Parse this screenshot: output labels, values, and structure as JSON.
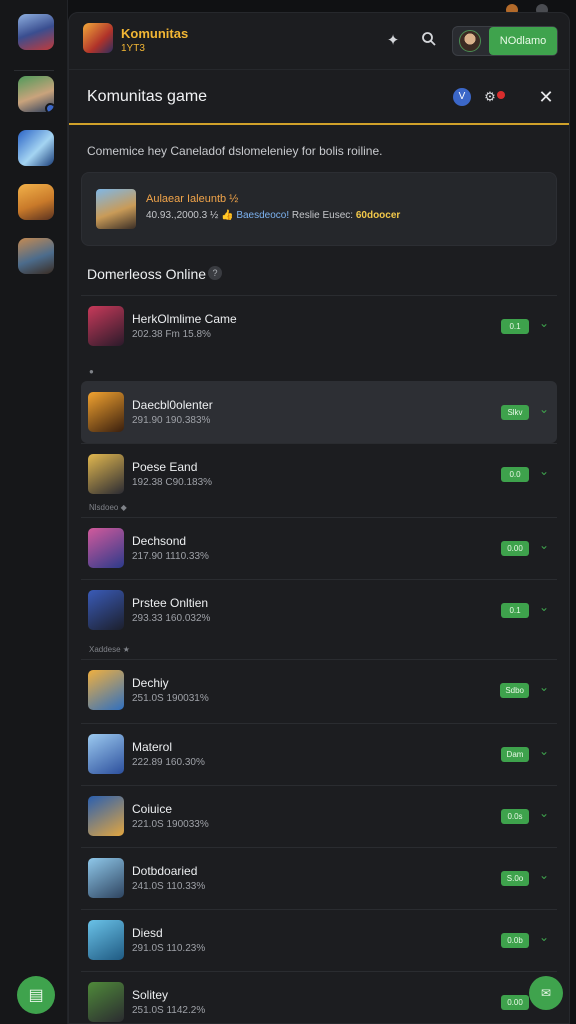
{
  "app": {
    "name": "Komunitas",
    "sub": "1YT3"
  },
  "user_chip": {
    "label": "NOdlamo"
  },
  "panel": {
    "title": "Komunitas game",
    "description": "Comemice hey Caneladof dslomeleniey for bolis roiline.",
    "v_badge": "V"
  },
  "featured": {
    "title": "Aulaear Ialeuntb ½",
    "meta_left": "40.93.,2000.3 ½",
    "meta_coin": "👍",
    "meta_blue": "Baesdeoco!",
    "meta_mid": "Reslie Eusec:",
    "meta_amount": "60doocer"
  },
  "section": {
    "title": "Domerleoss Online",
    "help": "?"
  },
  "groups": [
    {
      "label": "●"
    },
    {
      "label": "Nlsdoeo ◆"
    },
    {
      "label": "Xaddese ★"
    }
  ],
  "games": [
    {
      "name": "HerkOlmlime Came",
      "meta": "202.38 Fm 15.8%",
      "badge": "0.1",
      "icon_colors": [
        "#c83a5a",
        "#2a1a2a"
      ]
    },
    {
      "name": "Daecbl0olenter",
      "meta": "291.90 190.383%",
      "badge": "Slkv",
      "icon_colors": [
        "#f2a330",
        "#3a1f0e"
      ]
    },
    {
      "name": "Poese Eand",
      "meta": "192.38 C90.183%",
      "badge": "0.0",
      "icon_colors": [
        "#e2b84f",
        "#2b2b33"
      ]
    },
    {
      "name": "Dechsond",
      "meta": "217.90 1110.33%",
      "badge": "0.00",
      "icon_colors": [
        "#d25a9c",
        "#2c3a8a"
      ]
    },
    {
      "name": "Prstee Onltien",
      "meta": "293.33 160.032%",
      "badge": "0.1",
      "icon_colors": [
        "#3a5bb8",
        "#1c1f2c"
      ]
    },
    {
      "name": "Dechiy",
      "meta": "251.0S 190031%",
      "badge": "Sdbo",
      "icon_colors": [
        "#f0b040",
        "#2f6fc0"
      ]
    },
    {
      "name": "Materol",
      "meta": "222.89 160.30%",
      "badge": "Dam",
      "icon_colors": [
        "#9ccaf0",
        "#2c4f9c"
      ]
    },
    {
      "name": "Coiuice",
      "meta": "221.0S 190033%",
      "badge": "0.0s",
      "icon_colors": [
        "#2a5fb0",
        "#e2a640"
      ]
    },
    {
      "name": "Dotbdoaried",
      "meta": "241.0S 110.33%",
      "badge": "S.0o",
      "icon_colors": [
        "#8fc8ea",
        "#2e4460"
      ]
    },
    {
      "name": "Diesd",
      "meta": "291.0S 110.23%",
      "badge": "0.0b",
      "icon_colors": [
        "#6ac2e8",
        "#1f5a82"
      ]
    },
    {
      "name": "Solitey",
      "meta": "251.0S 1142.2%",
      "badge": "0.00",
      "icon_colors": [
        "#4f8a3a",
        "#2b2b30"
      ]
    }
  ],
  "colors": {
    "accent_green": "#3fa34d",
    "accent_gold": "#d0a12a",
    "panel_bg": "#1c1d20"
  },
  "icons": {
    "rail_fab": "list-icon",
    "chat_fab": "chat-icon",
    "compass": "compass-icon",
    "search": "search-icon",
    "gear": "gear-icon",
    "close": "close-icon"
  }
}
